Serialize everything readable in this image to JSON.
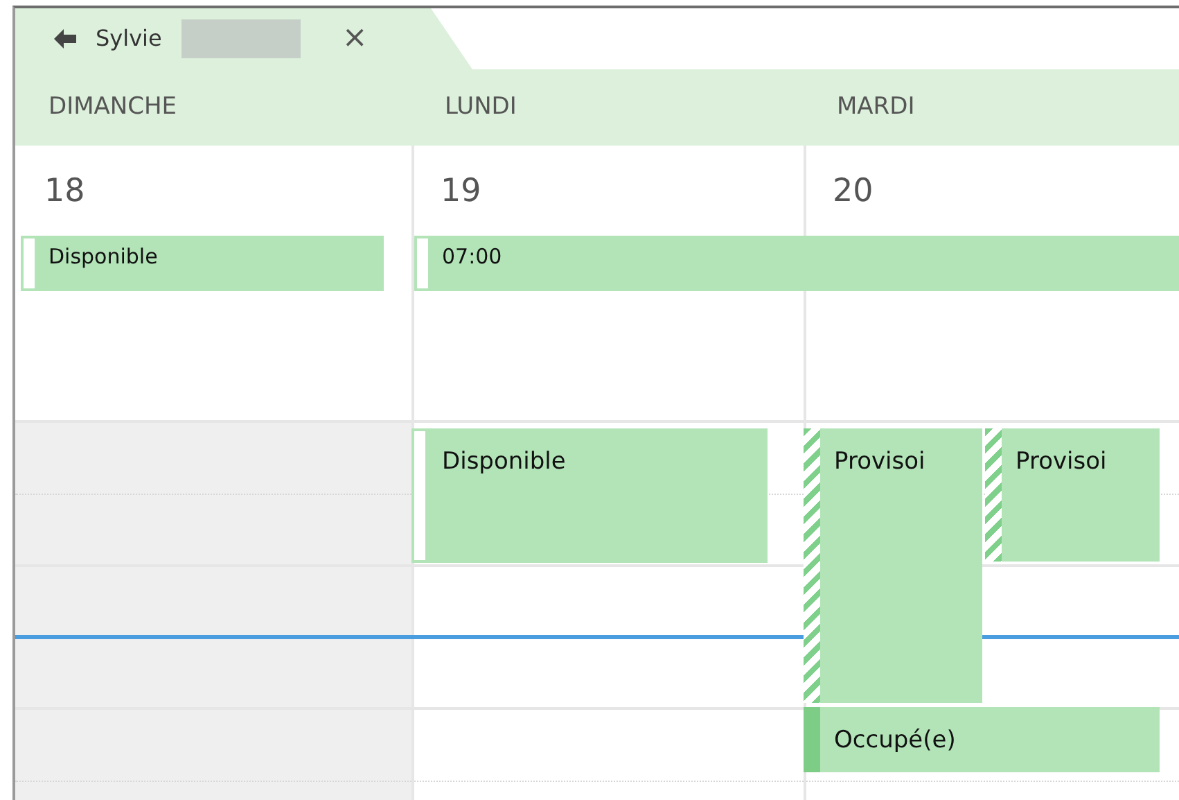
{
  "tab": {
    "name": "Sylvie",
    "close": "×"
  },
  "days": [
    {
      "name": "DIMANCHE",
      "date": "18"
    },
    {
      "name": "LUNDI",
      "date": "19"
    },
    {
      "name": "MARDI",
      "date": "20"
    }
  ],
  "all_day_events": [
    {
      "title": "Disponible",
      "kind": "free"
    },
    {
      "title": "07:00",
      "kind": "free"
    }
  ],
  "events": [
    {
      "title": "Disponible",
      "kind": "free"
    },
    {
      "title": "Provisoi",
      "kind": "tentative"
    },
    {
      "title": "Provisoi",
      "kind": "tentative"
    },
    {
      "title": "Occupé(e)",
      "kind": "busy"
    }
  ]
}
